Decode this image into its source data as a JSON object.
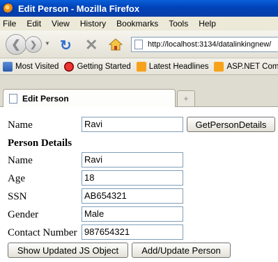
{
  "window": {
    "title": "Edit Person - Mozilla Firefox"
  },
  "menu": {
    "items": [
      "File",
      "Edit",
      "View",
      "History",
      "Bookmarks",
      "Tools",
      "Help"
    ]
  },
  "nav": {
    "url": "http://localhost:3134/datalinkingnew/"
  },
  "bookmarks": {
    "items": [
      {
        "label": "Most Visited",
        "icon": "most-visited-icon"
      },
      {
        "label": "Getting Started",
        "icon": "getting-started-icon"
      },
      {
        "label": "Latest Headlines",
        "icon": "rss-icon"
      },
      {
        "label": "ASP.NET Commun",
        "icon": "rss-icon"
      }
    ]
  },
  "tab": {
    "title": "Edit Person",
    "new_tab_symbol": "+"
  },
  "form": {
    "name_label": "Name",
    "name_value": "Ravi",
    "get_details_button": "GetPersonDetails",
    "details_heading": "Person Details",
    "details": [
      {
        "label": "Name",
        "value": "Ravi"
      },
      {
        "label": "Age",
        "value": "18"
      },
      {
        "label": "SSN",
        "value": "AB654321"
      },
      {
        "label": "Gender",
        "value": "Male"
      },
      {
        "label": "Contact Number",
        "value": "987654321"
      }
    ],
    "show_updated_button": "Show Updated JS Object",
    "add_update_button": "Add/Update Person"
  }
}
